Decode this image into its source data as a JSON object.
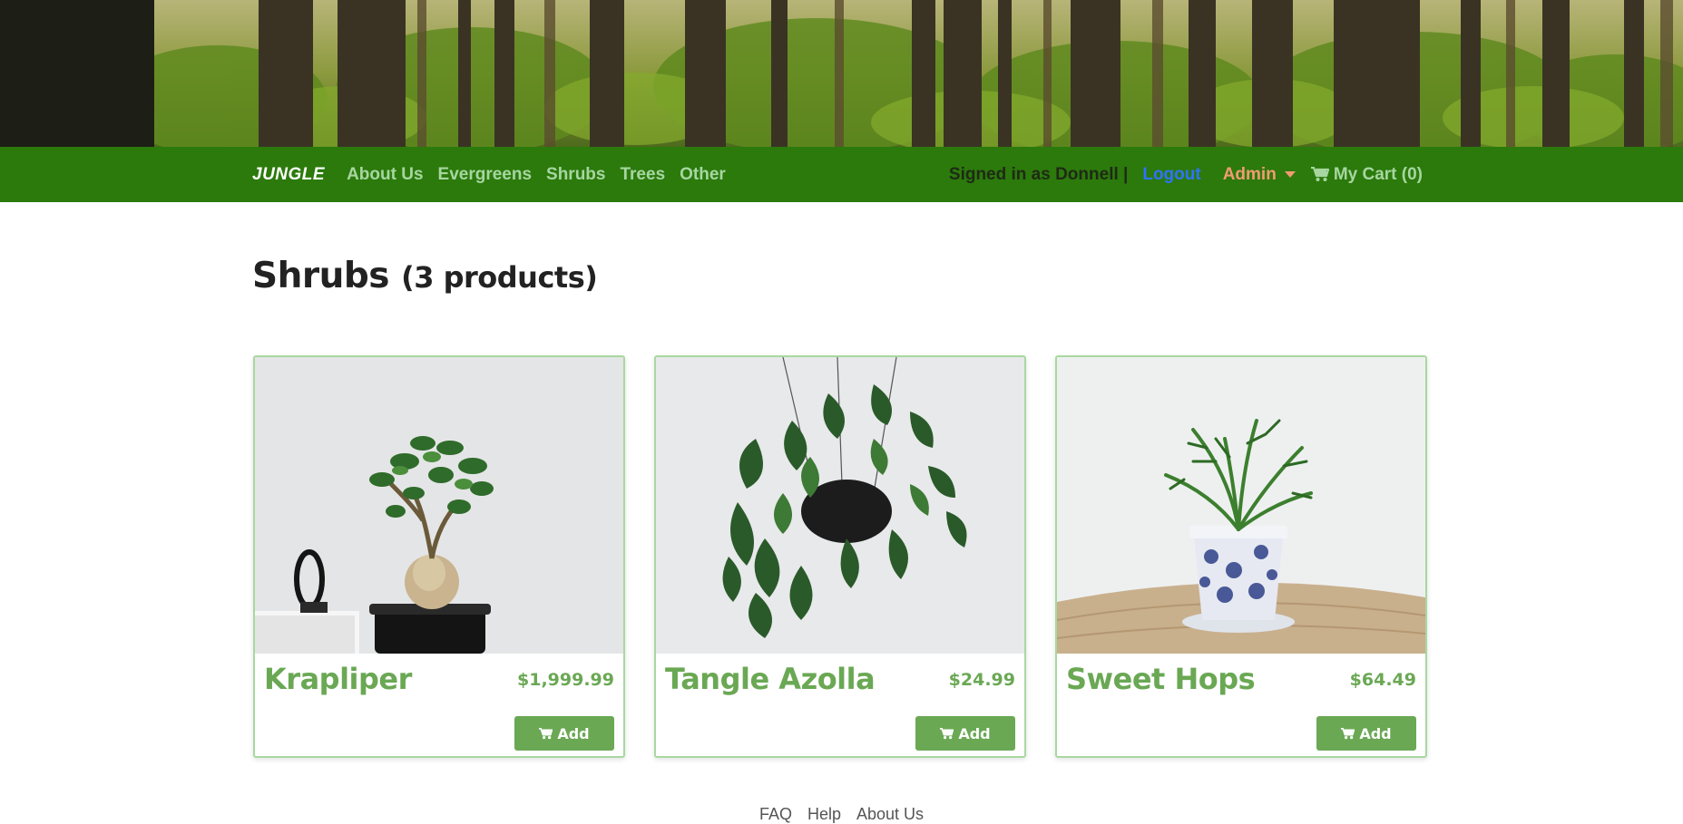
{
  "navbar": {
    "brand": "JUNGLE",
    "links": [
      "About Us",
      "Evergreens",
      "Shrubs",
      "Trees",
      "Other"
    ],
    "signed_in_text": "Signed in as Donnell |",
    "logout_label": "Logout",
    "admin_label": "Admin",
    "cart_label": "My Cart (0)",
    "icons": {
      "cart": "cart-icon",
      "admin_dropdown": "caret-down-icon"
    },
    "colors": {
      "background": "#2b7a0b",
      "link": "#a7d6a1",
      "logout": "#2e73ff",
      "admin": "#f29b73"
    }
  },
  "page": {
    "title": "Shrubs",
    "product_count": "(3 products)"
  },
  "products": [
    {
      "name": "Krapliper",
      "price": "$1,999.99",
      "add_label": "Add"
    },
    {
      "name": "Tangle Azolla",
      "price": "$24.99",
      "add_label": "Add"
    },
    {
      "name": "Sweet Hops",
      "price": "$64.49",
      "add_label": "Add"
    }
  ],
  "footer": {
    "links": [
      "FAQ",
      "Help",
      "About Us"
    ]
  },
  "theme": {
    "accent": "#6aa854",
    "card_border": "#a8d8a0"
  }
}
